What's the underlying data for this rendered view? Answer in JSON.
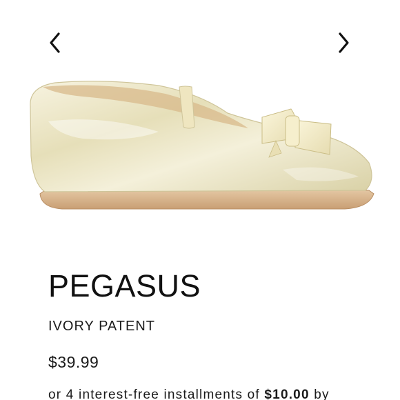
{
  "carousel": {
    "prev_icon": "chevron-left-icon",
    "next_icon": "chevron-right-icon",
    "image_alt": "ivory patent ballet flat with bow"
  },
  "product": {
    "title": "PEGASUS",
    "variant": "IVORY PATENT",
    "price": "$39.99",
    "installments_prefix": "or 4 interest-free installments of",
    "installments_amount": "$10.00",
    "installments_suffix": "by"
  },
  "colors": {
    "text": "#111111",
    "background": "#ffffff",
    "shoe_upper": "#ece6c4",
    "shoe_sole": "#d7b48e"
  }
}
